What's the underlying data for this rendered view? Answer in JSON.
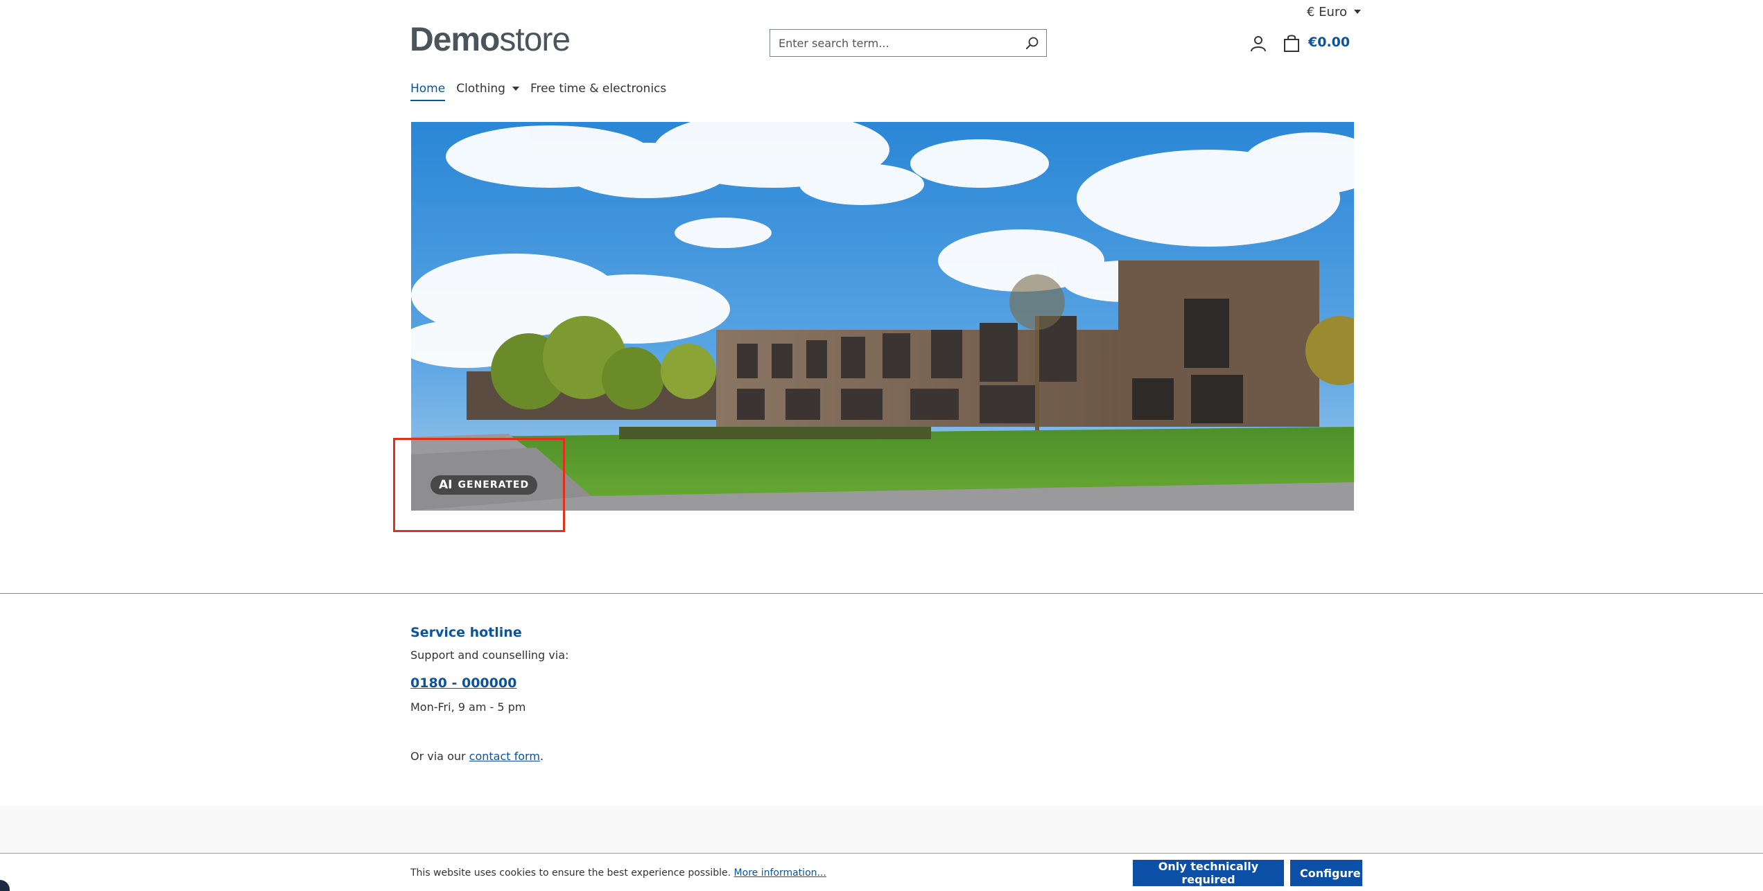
{
  "header": {
    "currency_label": "€ Euro",
    "logo_bold": "Demo",
    "logo_light": "store",
    "search_placeholder": "Enter search term...",
    "cart_total": "€0.00"
  },
  "nav": {
    "items": [
      {
        "label": "Home",
        "active": true
      },
      {
        "label": "Clothing",
        "has_dropdown": true
      },
      {
        "label": "Free time & electronics"
      }
    ]
  },
  "hero": {
    "badge_ai": "AI",
    "badge_text": "GENERATED"
  },
  "footer": {
    "service_title": "Service hotline",
    "support_text": "Support and counselling via:",
    "phone": "0180 - 000000",
    "hours": "Mon-Fri, 9 am - 5 pm",
    "contact_prefix": "Or via our ",
    "contact_link": "contact form",
    "contact_suffix": "."
  },
  "cookie": {
    "text": "This website uses cookies to ensure the best experience possible. ",
    "more_info": "More information...",
    "btn_required": "Only technically required",
    "btn_configure": "Configure"
  },
  "colors": {
    "brand": "#0b539b",
    "button": "#0b4fa6",
    "highlight": "#e0301e"
  },
  "icons": [
    "caret-down-icon",
    "search-icon",
    "account-icon",
    "cart-icon"
  ]
}
